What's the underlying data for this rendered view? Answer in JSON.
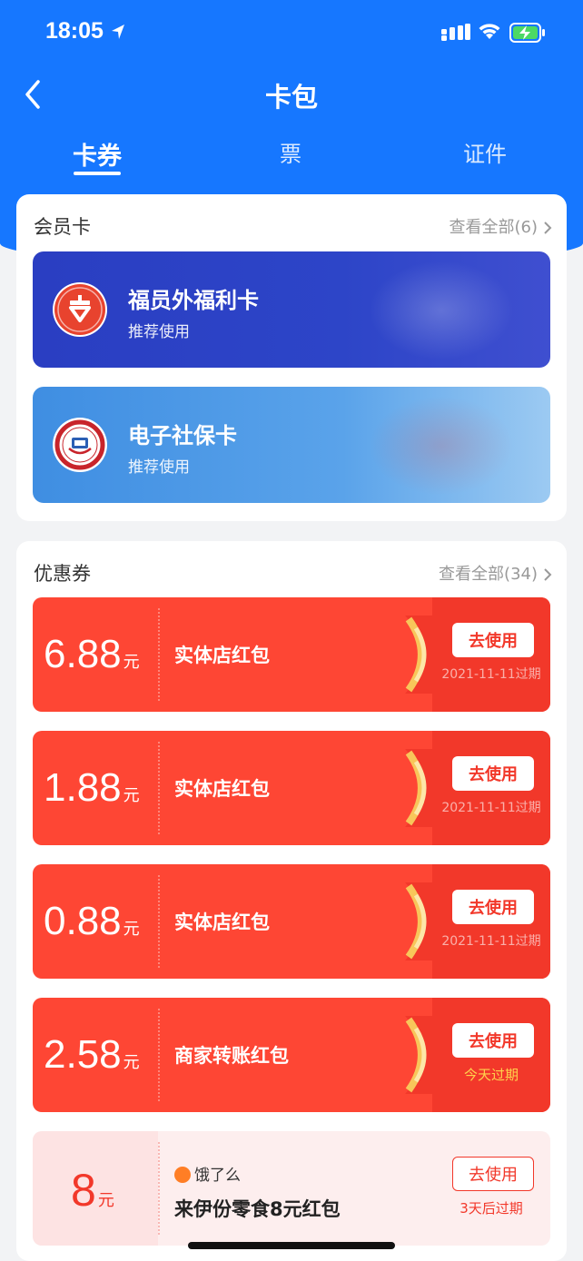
{
  "status": {
    "time": "18:05"
  },
  "nav": {
    "title": "卡包"
  },
  "tabs": [
    "卡券",
    "票",
    "证件"
  ],
  "membership": {
    "title": "会员卡",
    "more": "查看全部(6)",
    "cards": [
      {
        "name": "福员外福利卡",
        "sub": "推荐使用",
        "theme": "dark"
      },
      {
        "name": "电子社保卡",
        "sub": "推荐使用",
        "theme": "light"
      }
    ]
  },
  "coupons": {
    "title": "优惠券",
    "more": "查看全部(34)",
    "items": [
      {
        "amount": "6.88",
        "unit": "元",
        "title": "实体店红包",
        "button": "去使用",
        "expire": "2021-11-11过期"
      },
      {
        "amount": "1.88",
        "unit": "元",
        "title": "实体店红包",
        "button": "去使用",
        "expire": "2021-11-11过期"
      },
      {
        "amount": "0.88",
        "unit": "元",
        "title": "实体店红包",
        "button": "去使用",
        "expire": "2021-11-11过期"
      },
      {
        "amount": "2.58",
        "unit": "元",
        "title": "商家转账红包",
        "button": "去使用",
        "expire": "今天过期"
      },
      {
        "amount": "8",
        "unit": "元",
        "brand": "饿了么",
        "title": "来伊份零食8元红包",
        "button": "去使用",
        "expire": "3天后过期"
      }
    ]
  },
  "colors": {
    "primary": "#1677ff",
    "coupon_red": "#fe4634",
    "accent_yellow": "#ffd24c"
  }
}
